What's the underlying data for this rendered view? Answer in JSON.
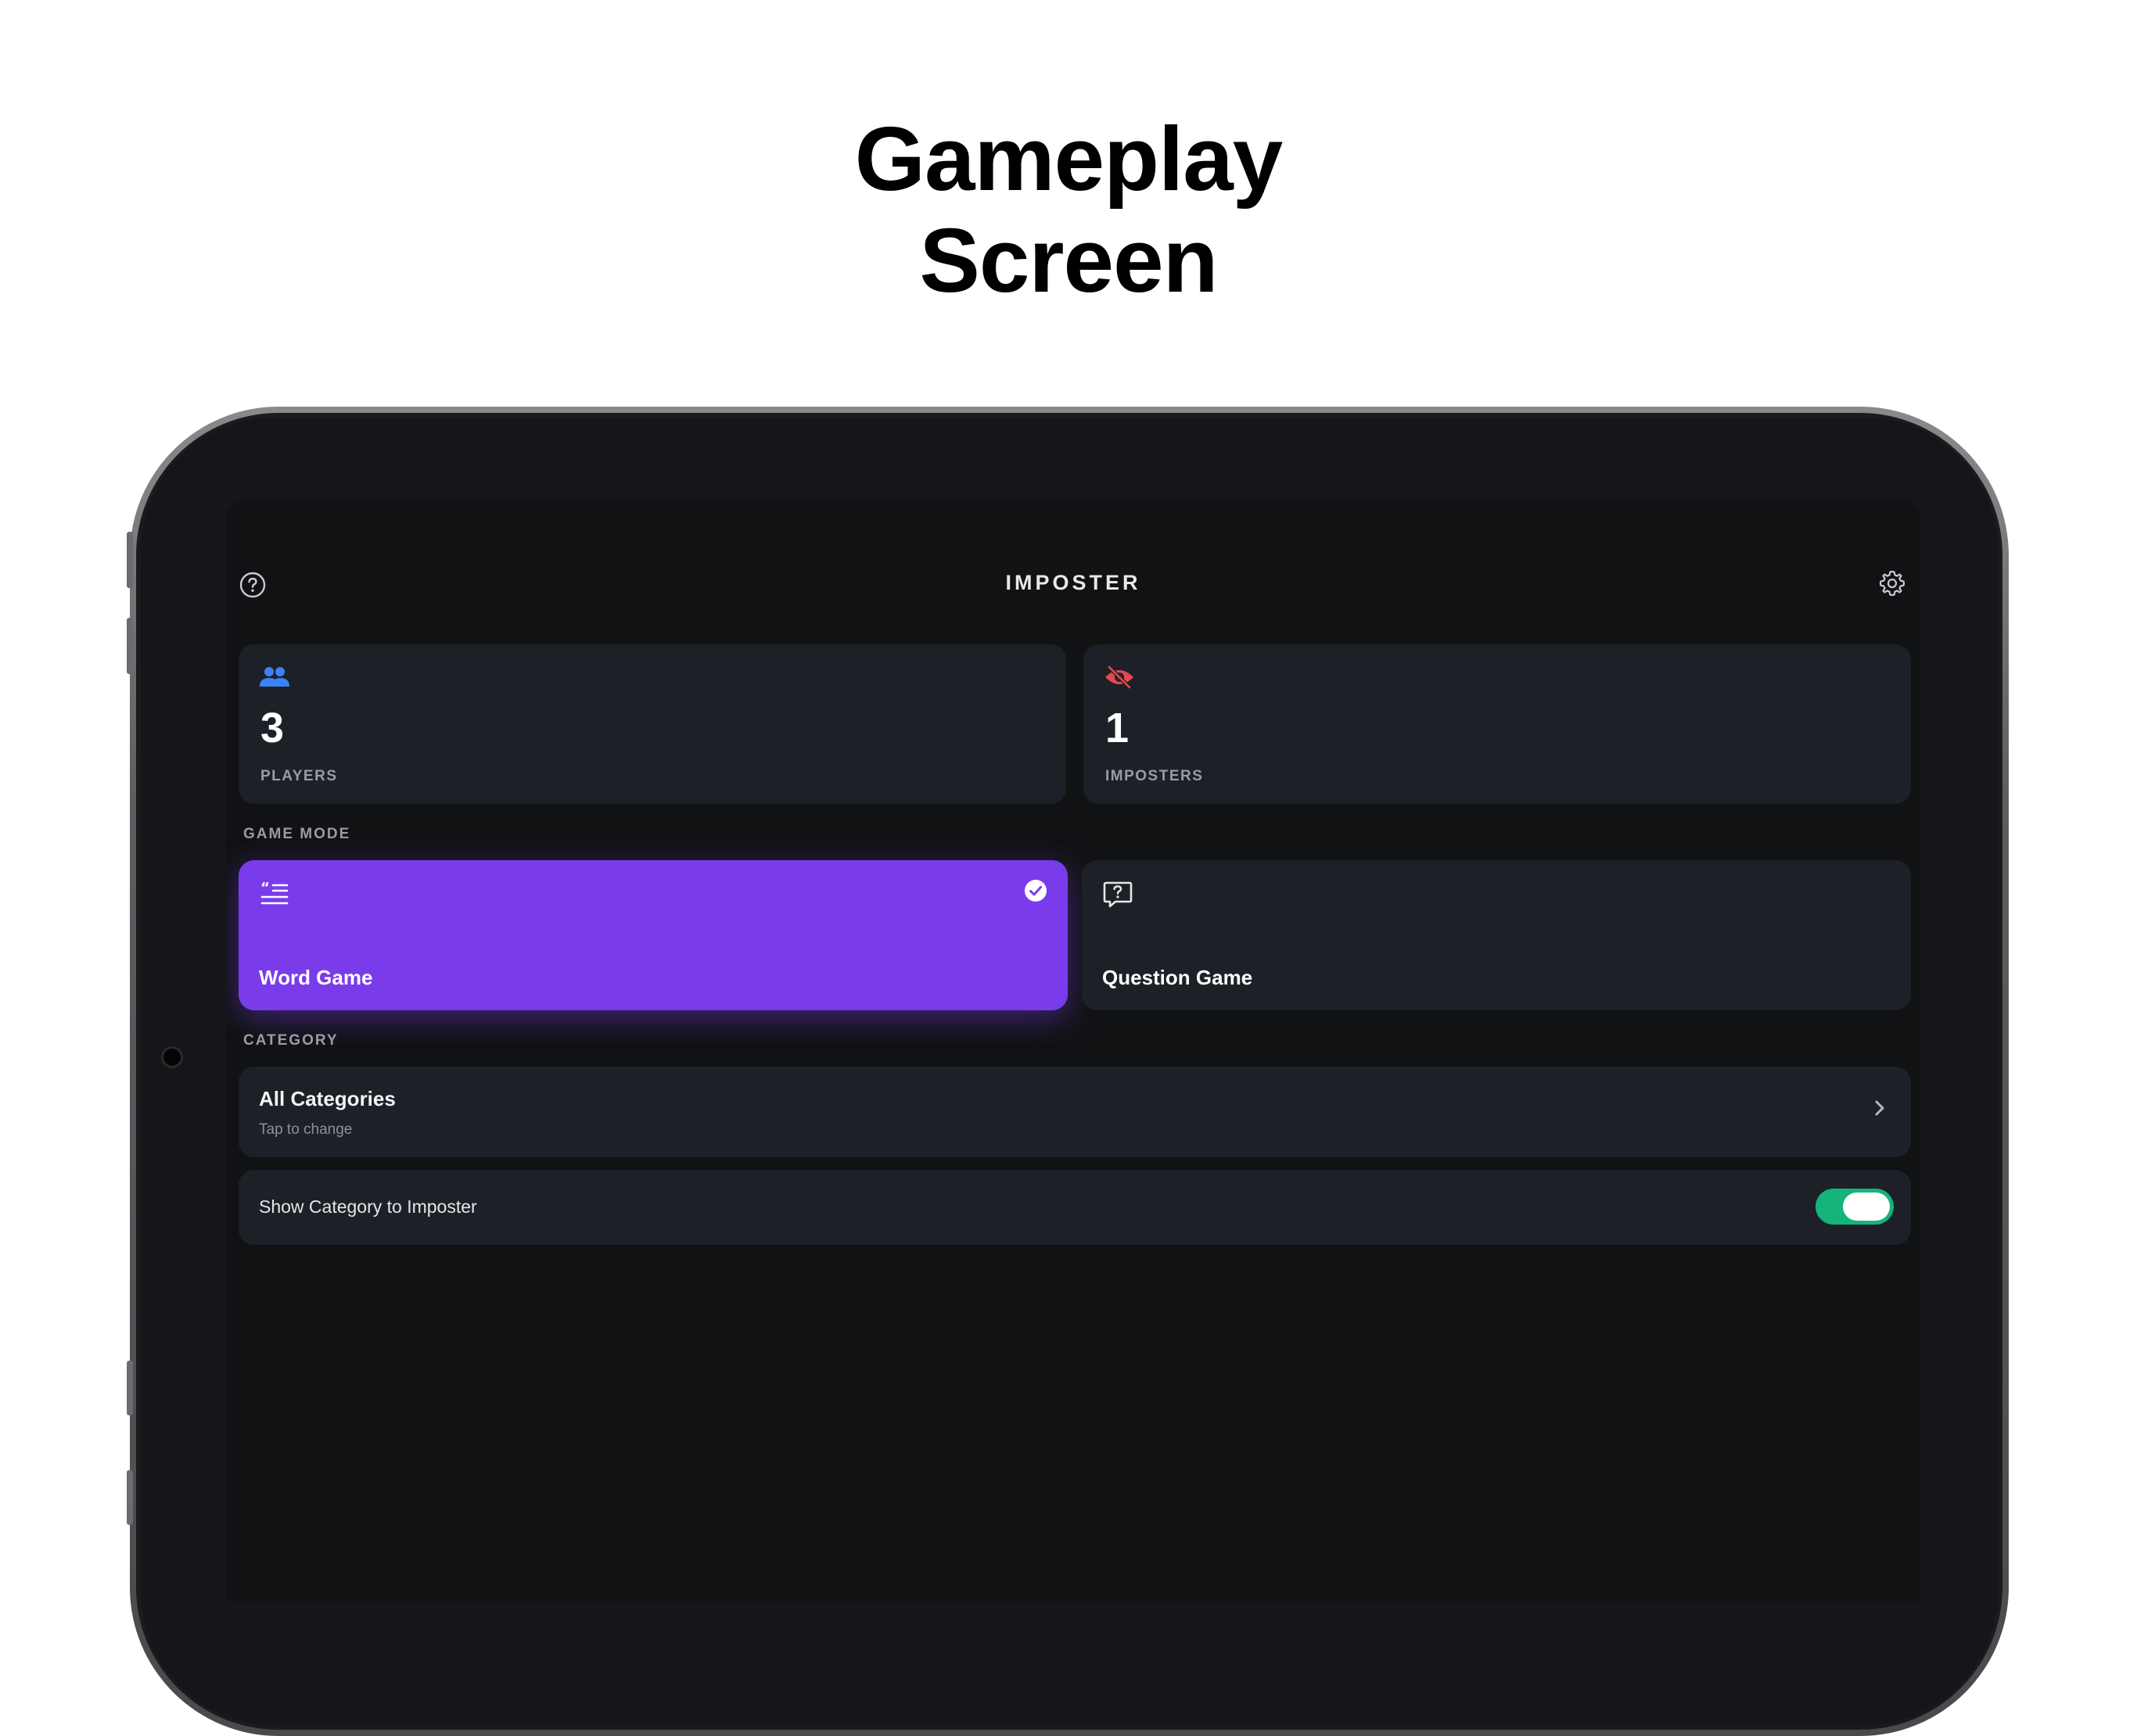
{
  "headline": {
    "line1": "Gameplay",
    "line2": "Screen"
  },
  "app": {
    "title": "IMPOSTER"
  },
  "icons": {
    "help": "question-circle-icon",
    "settings": "gear-icon",
    "players": "people-icon",
    "imposters": "eye-slash-icon",
    "word_game": "quote-list-icon",
    "question_game": "question-bubble-icon",
    "selected": "checkmark-circle-icon",
    "chevron": "chevron-right-icon"
  },
  "stats": {
    "players": {
      "value": "3",
      "label": "PLAYERS"
    },
    "imposters": {
      "value": "1",
      "label": "IMPOSTERS"
    }
  },
  "game_mode": {
    "section_label": "GAME MODE",
    "options": [
      {
        "label": "Word Game",
        "selected": true
      },
      {
        "label": "Question Game",
        "selected": false
      }
    ]
  },
  "category": {
    "section_label": "CATEGORY",
    "value": "All Categories",
    "hint": "Tap to change"
  },
  "show_category": {
    "label": "Show Category to Imposter",
    "enabled": true
  },
  "colors": {
    "accent_purple": "#7a3cea",
    "toggle_on": "#14b47b",
    "players_icon": "#3b82f6",
    "imposters_icon": "#e5484d",
    "card_bg": "#1e2027",
    "screen_bg": "#111214"
  }
}
